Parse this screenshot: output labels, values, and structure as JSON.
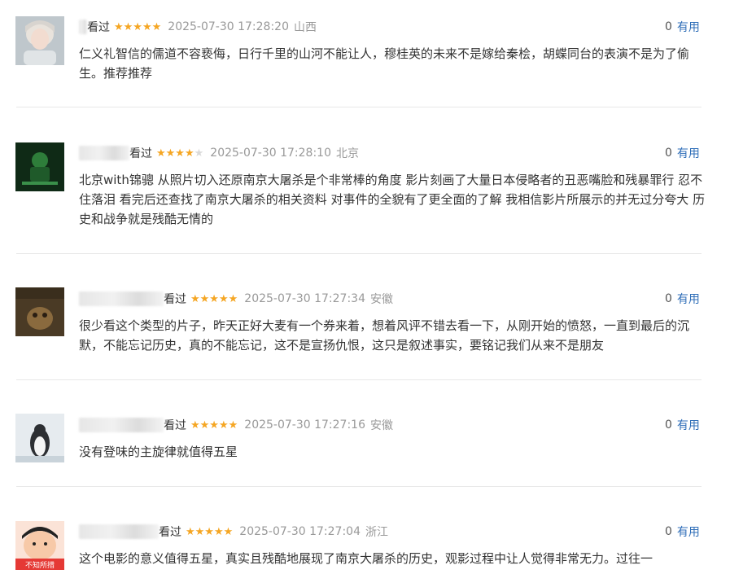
{
  "reviews": [
    {
      "watched_label": "看过",
      "rating": 5,
      "time": "2025-07-30 17:28:20",
      "location": "山西",
      "useful_count": "0",
      "useful_label": "有用",
      "content": "仁义礼智信的儒道不容亵侮，日行千里的山河不能让人，穆桂英的未来不是嫁给秦桧，胡蝶同台的表演不是为了偷生。推荐推荐"
    },
    {
      "watched_label": "看过",
      "rating": 4,
      "time": "2025-07-30 17:28:10",
      "location": "北京",
      "useful_count": "0",
      "useful_label": "有用",
      "content": "北京with锦骢 从照片切入还原南京大屠杀是个非常棒的角度 影片刻画了大量日本侵略者的丑恶嘴脸和残暴罪行 忍不住落泪 看完后还查找了南京大屠杀的相关资料 对事件的全貌有了更全面的了解 我相信影片所展示的并无过分夸大 历史和战争就是残酷无情的"
    },
    {
      "watched_label": "看过",
      "rating": 5,
      "time": "2025-07-30 17:27:34",
      "location": "安徽",
      "useful_count": "0",
      "useful_label": "有用",
      "content": "很少看这个类型的片子，昨天正好大麦有一个券来着，想着风评不错去看一下，从刚开始的愤怒，一直到最后的沉默，不能忘记历史，真的不能忘记，这不是宣扬仇恨，这只是叙述事实，要铭记我们从来不是朋友"
    },
    {
      "watched_label": "看过",
      "rating": 5,
      "time": "2025-07-30 17:27:16",
      "location": "安徽",
      "useful_count": "0",
      "useful_label": "有用",
      "content": "没有登味的主旋律就值得五星"
    },
    {
      "watched_label": "看过",
      "rating": 5,
      "time": "2025-07-30 17:27:04",
      "location": "浙江",
      "useful_count": "0",
      "useful_label": "有用",
      "content": "这个电影的意义值得五星，真实且残酷地展现了南京大屠杀的历史，观影过程中让人觉得非常无力。过往一"
    }
  ],
  "avatar_captions": {
    "review_3": "",
    "review_5": "不知所措"
  },
  "colors": {
    "star": "#f5a623",
    "useful_link": "#2f6eb8",
    "meta_gray": "#999999"
  }
}
